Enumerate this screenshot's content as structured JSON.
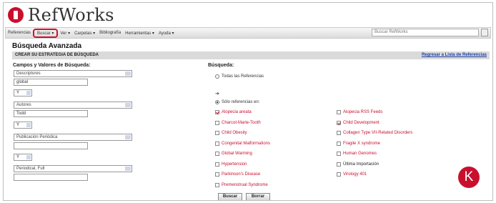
{
  "app": {
    "logo_text": "RefWorks",
    "logo_icon": "refworks-logo-icon"
  },
  "menubar": {
    "items": [
      "Referencias",
      "Buscar",
      "Ver",
      "Carpetas",
      "Bibliografía",
      "Herramientas",
      "Ayuda"
    ],
    "search_placeholder": "Buscar RefWorks"
  },
  "page": {
    "title": "Búsqueda Avanzada",
    "strategy_label": "CREAR SU ESTRATEGIA DE BÚSQUEDA",
    "return_link": "Regresar a Lista de Referencias"
  },
  "fields_panel": {
    "heading": "Campos y Valores de Búsqueda:",
    "rows": [
      {
        "field": "Descriptores",
        "value": "global"
      },
      {
        "field": "Autores",
        "value": "Todd"
      },
      {
        "field": "Publicación Periódica",
        "value": ""
      },
      {
        "field": "Periodical, Full",
        "value": ""
      }
    ],
    "operators": [
      "Y",
      "Y",
      "Y"
    ]
  },
  "search_in": {
    "heading": "Búsqueda:",
    "option_all": "Todas las Referencias",
    "option_only": "Sólo referencias en:",
    "folders_left": [
      {
        "label": "Alopecia areata",
        "checked": true
      },
      {
        "label": "Charcot-Marie-Tooth",
        "checked": false
      },
      {
        "label": "Child Obesity",
        "checked": false
      },
      {
        "label": "Congenital Malformations",
        "checked": false
      },
      {
        "label": "Global Warming",
        "checked": false
      },
      {
        "label": "Hypertension",
        "checked": false
      },
      {
        "label": "Parkinson's Disease",
        "checked": false
      },
      {
        "label": "Premenstrual Syndrome",
        "checked": false
      }
    ],
    "folders_right": [
      {
        "label": "Alopecia RSS Feeds",
        "checked": false
      },
      {
        "label": "Child Development",
        "checked": true
      },
      {
        "label": "Collagen Type VII-Related Disorders",
        "checked": false
      },
      {
        "label": "Fragile X syndrome",
        "checked": false
      },
      {
        "label": "Human Genomes",
        "checked": false
      },
      {
        "label": "Última Importación",
        "checked": false
      },
      {
        "label": "Virology 401",
        "checked": false
      }
    ]
  },
  "buttons": {
    "search": "Buscar",
    "clear": "Borrar"
  },
  "badge": "K",
  "colors": {
    "accent": "#c8102e",
    "link": "#1a3fa8"
  }
}
